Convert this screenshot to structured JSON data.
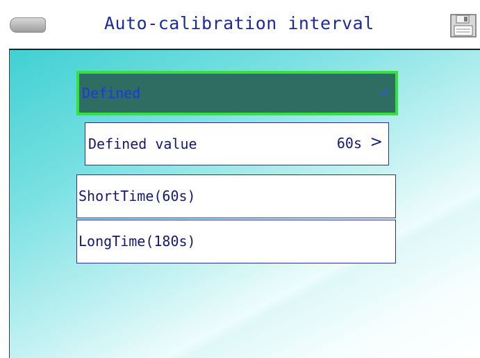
{
  "header": {
    "title": "Auto-calibration interval",
    "back_icon": "back-arrow-icon",
    "save_icon": "floppy-disk-icon"
  },
  "options": [
    {
      "label": "Defined",
      "selected": true,
      "indicator": "✓"
    },
    {
      "label": "Defined value",
      "value": "60s",
      "chevron": ">"
    },
    {
      "label": "ShortTime(60s)",
      "selected": false
    },
    {
      "label": "LongTime(180s)",
      "selected": false
    }
  ],
  "colors": {
    "title_text": "#1c2a9c",
    "selected_bg": "#2f6d62",
    "selected_border": "#33e23d",
    "row_border": "#2c2fa0",
    "background_accent": "#41d0d2"
  }
}
